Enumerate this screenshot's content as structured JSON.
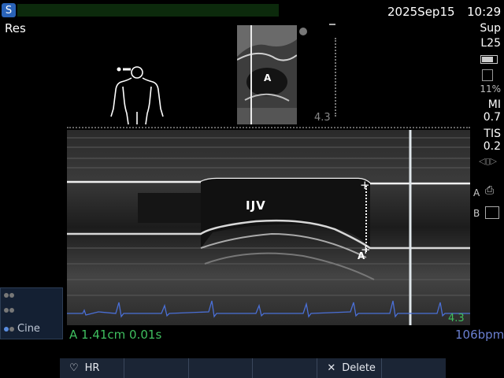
{
  "header": {
    "logo_glyph": "S",
    "date": "2025Sep15",
    "time": "10:29",
    "mode_label": "Res"
  },
  "right_panel": {
    "preset": "Sup",
    "probe": "L25",
    "battery_icon": "battery-icon",
    "save_icon": "floppy-icon",
    "power_pct": "11%",
    "mi_label": "MI",
    "mi_value": "0.7",
    "tis_label": "TIS",
    "tis_value": "0.2",
    "print_a_label": "A",
    "print_b_label": "B"
  },
  "preview": {
    "marker_label": "A",
    "depth": "4.3"
  },
  "scan": {
    "structure_label": "IJV",
    "caliper_label": "A",
    "depth": "4.3"
  },
  "measurement": {
    "text": "A  1.41cm 0.01s"
  },
  "heart_rate": {
    "text": "106bpm"
  },
  "cine": {
    "label": "Cine"
  },
  "buttons": {
    "hr_label": "HR",
    "delete_label": "Delete"
  },
  "colors": {
    "measurement_green": "#3fbf5f",
    "ecg_blue": "#4a6fd6",
    "hr_blue": "#6a7fd1",
    "button_bar": "#1b2535"
  }
}
